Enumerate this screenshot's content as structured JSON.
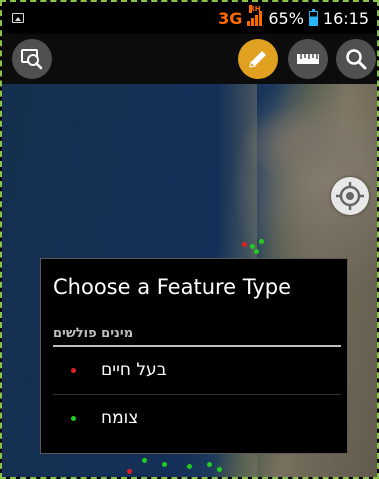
{
  "status_bar": {
    "network": "3G",
    "network_sub": "RH",
    "battery_percent": "65%",
    "time": "16:15",
    "battery_level": 0.65,
    "colors": {
      "network": "#ff6a00",
      "battery": "#29b6f6"
    }
  },
  "action_bar": {
    "left_button": {
      "icon": "map-search-icon"
    },
    "buttons": [
      {
        "icon": "pencil-icon",
        "active": true
      },
      {
        "icon": "ruler-icon",
        "active": false
      },
      {
        "icon": "search-icon",
        "active": false
      }
    ],
    "accent_color": "#e0a020"
  },
  "map": {
    "gps_button_icon": "gps-target-icon",
    "marker_colors": {
      "green": "#22cc22",
      "red": "#e02020"
    }
  },
  "dialog": {
    "title": "Choose a Feature Type",
    "section_header": "מינים פולשים",
    "items": [
      {
        "label": "בעל חיים",
        "color": "#e02020"
      },
      {
        "label": "צומח",
        "color": "#22cc22"
      }
    ]
  }
}
